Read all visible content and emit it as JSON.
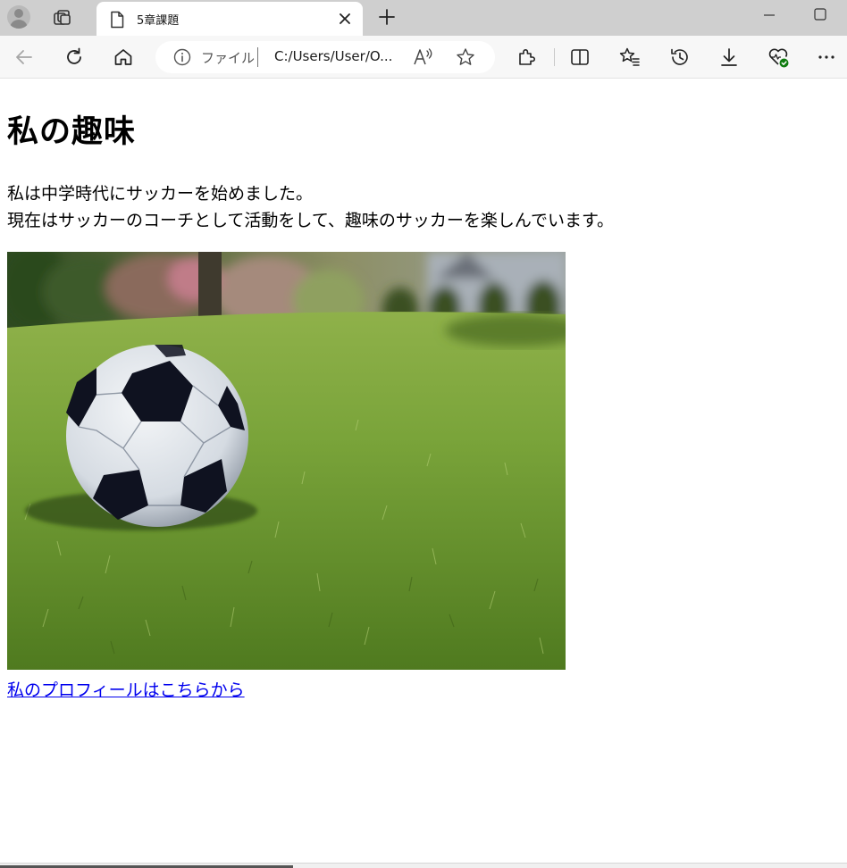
{
  "browser": {
    "tab": {
      "title": "5章課題"
    },
    "address": {
      "scheme_label": "ファイル",
      "url": "C:/Users/User/O..."
    }
  },
  "page": {
    "heading": "私の趣味",
    "paragraph_lines": [
      "私は中学時代にサッカーを始めました。",
      "現在はサッカーのコーチとして活動をして、趣味のサッカーを楽しんでいます。"
    ],
    "image": {
      "subject": "soccer ball on grass"
    },
    "link_text": "私のプロフィールはこちらから"
  },
  "icons": {
    "profile": "profile-avatar-icon",
    "tabs": "tab-actions-icon",
    "document": "document-icon",
    "close": "close-icon",
    "new_tab": "plus-icon",
    "back": "back-arrow-icon",
    "refresh": "refresh-icon",
    "home": "home-icon",
    "info": "info-icon",
    "read_aloud": "read-aloud-icon",
    "favorite": "star-icon",
    "extensions": "puzzle-icon",
    "split": "split-screen-icon",
    "favorites": "favorites-icon",
    "history": "history-icon",
    "downloads": "download-icon",
    "health": "browser-essentials-icon",
    "more": "more-icon"
  },
  "colors": {
    "link": "#0000ee",
    "tabstrip": "#cfcfcf",
    "toolbar": "#f7f7f7"
  }
}
